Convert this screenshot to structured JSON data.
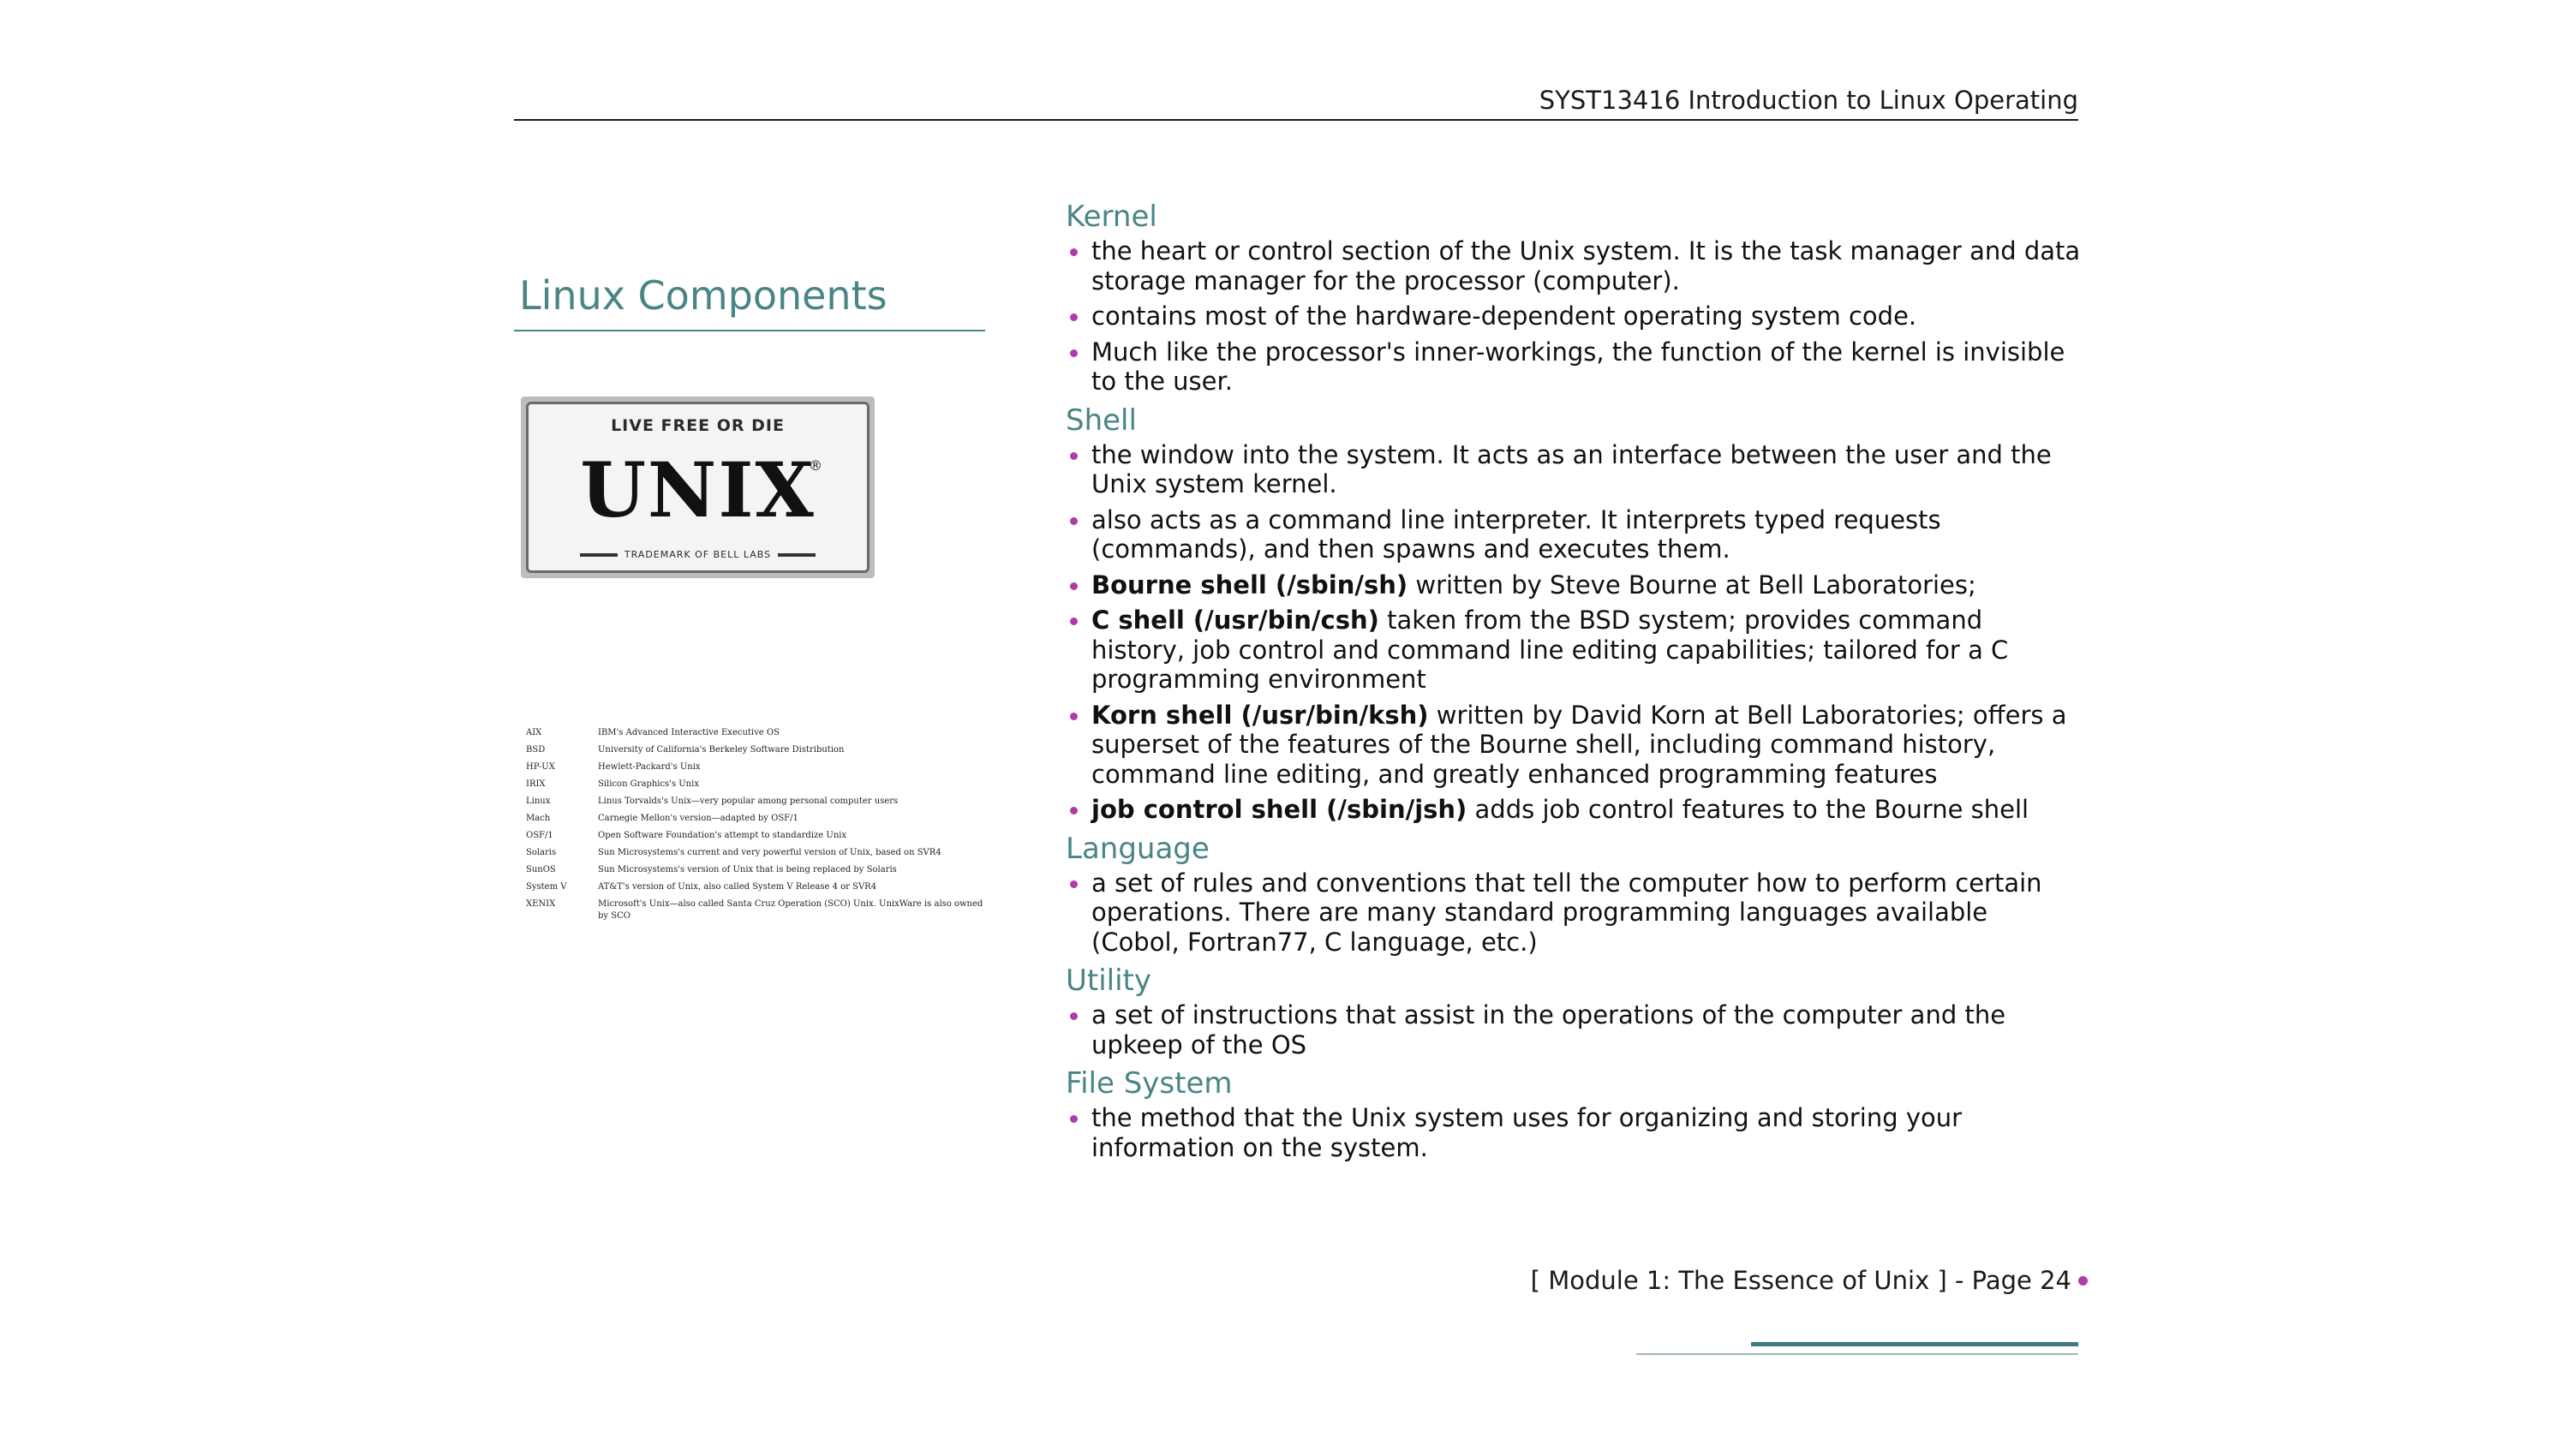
{
  "header": {
    "title": "SYST13416 Introduction to Linux Operating"
  },
  "sidebar": {
    "section_title": "Linux Components",
    "plate": {
      "top_text": "LIVE FREE OR DIE",
      "main_text": "UNIX",
      "registered_mark": "®",
      "bottom_text": "TRADEMARK OF BELL LABS"
    },
    "unix_versions": [
      {
        "name": "AIX",
        "desc": "IBM's Advanced Interactive Executive OS"
      },
      {
        "name": "BSD",
        "desc": "University of California's Berkeley Software Distribution"
      },
      {
        "name": "HP-UX",
        "desc": "Hewlett-Packard's Unix"
      },
      {
        "name": "IRIX",
        "desc": "Silicon Graphics's Unix"
      },
      {
        "name": "Linux",
        "desc": "Linus Torvalds's Unix—very popular among personal computer users"
      },
      {
        "name": "Mach",
        "desc": "Carnegie Mellon's version—adapted by OSF/1"
      },
      {
        "name": "OSF/1",
        "desc": "Open Software Foundation's attempt to standardize Unix"
      },
      {
        "name": "Solaris",
        "desc": "Sun Microsystems's current and very powerful version of Unix, based on SVR4"
      },
      {
        "name": "SunOS",
        "desc": "Sun Microsystems's version of Unix that is being replaced by Solaris"
      },
      {
        "name": "System V",
        "desc": "AT&T's version of Unix, also called System V Release 4 or SVR4"
      },
      {
        "name": "XENIX",
        "desc": "Microsoft's Unix—also called Santa Cruz Operation (SCO) Unix. UnixWare is also owned by SCO"
      }
    ]
  },
  "topics": [
    {
      "heading": "Kernel",
      "bullets": [
        {
          "bold": "",
          "text": "the heart or control section of the Unix system.  It is the task manager and data storage manager for the processor (computer)."
        },
        {
          "bold": "",
          "text": "contains most of the hardware-dependent operating system code."
        },
        {
          "bold": "",
          "text": "Much like the processor's inner-workings, the function of the kernel is invisible to the user."
        }
      ]
    },
    {
      "heading": "Shell",
      "bullets": [
        {
          "bold": "",
          "text": "the window into the system. It acts as an interface between the user and the Unix system kernel."
        },
        {
          "bold": "",
          "text": "also acts as a command line interpreter. It interprets typed requests (commands), and then spawns and executes them."
        },
        {
          "bold": "Bourne shell (/sbin/sh)",
          "text": " written by Steve Bourne at Bell Laboratories;"
        },
        {
          "bold": "C shell (/usr/bin/csh)",
          "text": " taken from the BSD system; provides command history, job control and command line editing capabilities; tailored for a C programming environment"
        },
        {
          "bold": "Korn shell (/usr/bin/ksh)",
          "text": " written by David Korn at Bell Laboratories; offers a superset of the features of the Bourne shell, including command history, command line editing, and greatly enhanced programming features"
        },
        {
          "bold": "job control shell (/sbin/jsh)",
          "text": " adds job control features to the Bourne shell"
        }
      ]
    },
    {
      "heading": "Language",
      "bullets": [
        {
          "bold": "",
          "text": "a set of rules and conventions that tell the computer how to perform certain operations.  There are many standard programming languages available (Cobol, Fortran77, C language, etc.)"
        }
      ]
    },
    {
      "heading": "Utility",
      "bullets": [
        {
          "bold": "",
          "text": "a set of instructions that assist in the operations of the computer and the upkeep of the OS"
        }
      ]
    },
    {
      "heading": "File System",
      "bullets": [
        {
          "bold": "",
          "text": "the method that the Unix system uses for organizing and storing your information on the system."
        }
      ]
    }
  ],
  "footer": {
    "text": "[ Module 1:  The Essence of Unix  ] - Page 24"
  },
  "colors": {
    "accent_teal": "#4a8585",
    "bullet_magenta": "#b03aa8",
    "footer_rule": "#3d7c84"
  }
}
